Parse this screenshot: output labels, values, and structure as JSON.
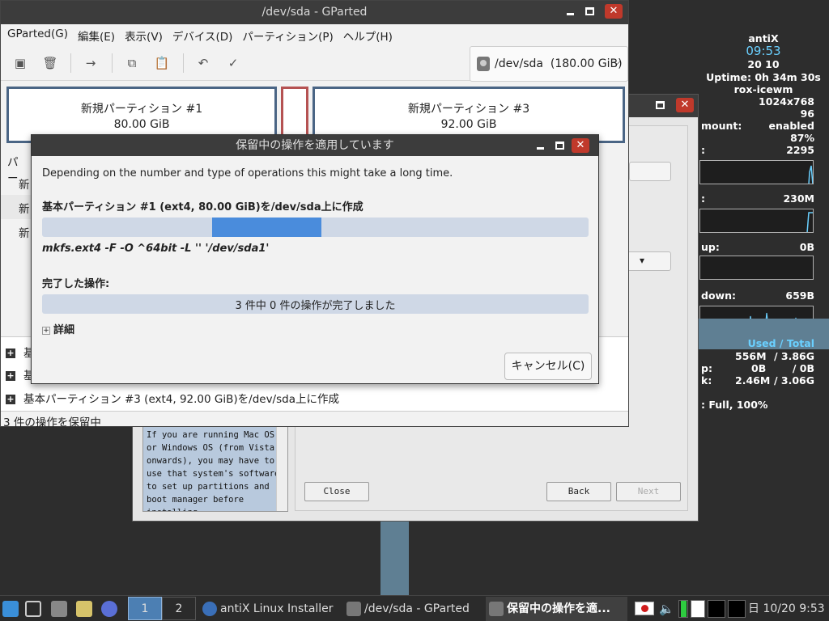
{
  "conky": {
    "host": "antiX",
    "time": "09:53",
    "date": " 20 10",
    "uptime": "Uptime: 0h 34m 30s",
    "wm": "rox-icewm",
    "resolution": "1024x768",
    "dpi": "96",
    "automount_label": "mount:",
    "automount_value": "enabled",
    "battery_value": "87%",
    "cpu_label": ":",
    "cpu_value": "2295",
    "ram_label": ":",
    "ram_value": "230M",
    "net_up_label": "up:",
    "net_up_value": "0B",
    "net_down_label": "down:",
    "net_down_value": "659B",
    "used_total": "Used / Total",
    "mem_label": "",
    "mem_used": "556M",
    "mem_total": "/ 3.86G",
    "swap_label": "p:",
    "swap_used": "0B",
    "swap_total": "/ 0B",
    "disk_label": "k:",
    "disk_used": "2.46M",
    "disk_total": "/ 3.06G",
    "battery_status": ": Full, 100%"
  },
  "installer": {
    "info_text": "If you are running Mac OS or Windows OS (from Vista onwards), you may have to use that system's software to set up partitions and boot manager before installing.",
    "close_label": "Close",
    "back_label": "Back",
    "next_label": "Next"
  },
  "gparted": {
    "title": "/dev/sda - GParted",
    "menu": [
      "GParted(G)",
      "編集(E)",
      "表示(V)",
      "デバイス(D)",
      "パーティション(P)",
      "ヘルプ(H)"
    ],
    "device": "/dev/sda",
    "device_size": "(180.00 GiB)",
    "partitions": [
      {
        "name": "新規パーティション #1",
        "size": "80.00 GiB"
      },
      {
        "name": "新規パーティション #3",
        "size": "92.00 GiB"
      }
    ],
    "list_header": "パー",
    "list_rows": [
      "新",
      "新",
      "新"
    ],
    "pending_ops": [
      "基",
      "基",
      "基本パーティション #3 (ext4, 92.00 GiB)を/dev/sda上に作成"
    ],
    "status": "3 件の操作を保留中"
  },
  "dialog": {
    "title": "保留中の操作を適用しています",
    "description": "Depending on the number and type of operations this might take a long time.",
    "current_operation": "基本パーティション #1 (ext4, 80.00 GiB)を/dev/sda上に作成",
    "command": "mkfs.ext4 -F -O ^64bit -L '' '/dev/sda1'",
    "completed_label": "完了した操作:",
    "completed_text": "3 件中 0 件の操作が完了しました",
    "completed_fraction": 0.0,
    "details_label": "詳細",
    "cancel_label": "キャンセル(C)"
  },
  "taskbar": {
    "pager": [
      "1",
      "2"
    ],
    "tasks": [
      {
        "label": "antiX Linux Installer",
        "icon": "globe-icon"
      },
      {
        "label": "/dev/sda - GParted",
        "icon": "disk-icon"
      },
      {
        "label": "保留中の操作を適...",
        "icon": "disk-icon"
      }
    ],
    "clock": "日 10/20  9:53"
  },
  "colors": {
    "accent": "#4a8cdc",
    "progress_track": "#cfd8e6",
    "partition_border": "#4a6585",
    "unallocated_border": "#b55252",
    "conky_text": "#ffffff",
    "conky_highlight": "#6ad0ff"
  }
}
